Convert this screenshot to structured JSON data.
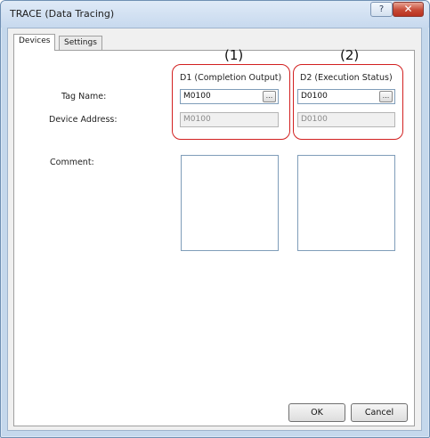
{
  "window": {
    "title": "TRACE (Data Tracing)",
    "help_label": "?",
    "close_label": "✕"
  },
  "tabs": [
    {
      "label": "Devices",
      "active": true
    },
    {
      "label": "Settings",
      "active": false
    }
  ],
  "annotations": {
    "col1": "(1)",
    "col2": "(2)"
  },
  "devices": {
    "d1": {
      "header": "D1 (Completion Output)",
      "tag_name": "M0100",
      "device_address": "M0100",
      "comment": ""
    },
    "d2": {
      "header": "D2 (Execution Status)",
      "tag_name": "D0100",
      "device_address": "D0100",
      "comment": ""
    }
  },
  "labels": {
    "tag_name": "Tag Name:",
    "device_address": "Device Address:",
    "comment": "Comment:",
    "browse": "..."
  },
  "buttons": {
    "ok": "OK",
    "cancel": "Cancel"
  },
  "colors": {
    "callout": "#d22020",
    "title_bar": "#c7d9ee",
    "close_button": "#c74a36"
  }
}
